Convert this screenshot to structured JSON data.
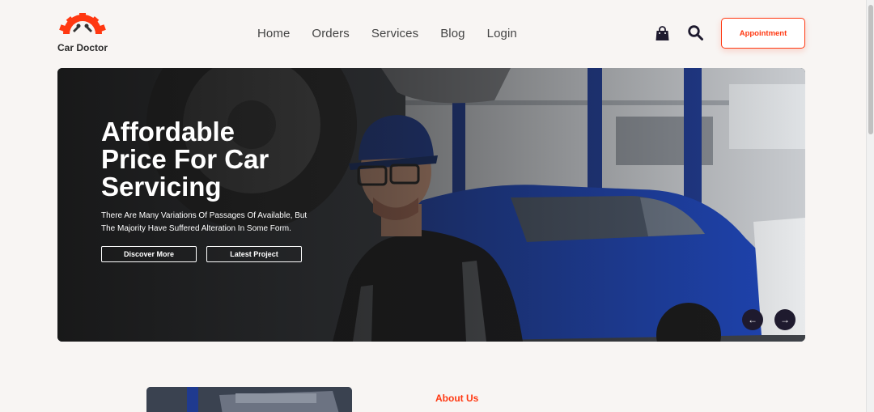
{
  "brand": {
    "name": "Car Doctor",
    "accent": "#ff3811"
  },
  "nav": {
    "items": [
      "Home",
      "Orders",
      "Services",
      "Blog",
      "Login"
    ]
  },
  "header": {
    "bag_icon": "shopping-bag-icon",
    "search_icon": "search-icon",
    "appointment_label": "Appointment"
  },
  "hero": {
    "title": "Affordable Price For Car Servicing",
    "description": "There Are Many Variations Of Passages Of Available, But The Majority Have Suffered Alteration In Some Form.",
    "primary_button": "Discover More",
    "secondary_button": "Latest Project",
    "prev_icon": "arrow-left-icon",
    "next_icon": "arrow-right-icon"
  },
  "about": {
    "label": "About Us"
  }
}
